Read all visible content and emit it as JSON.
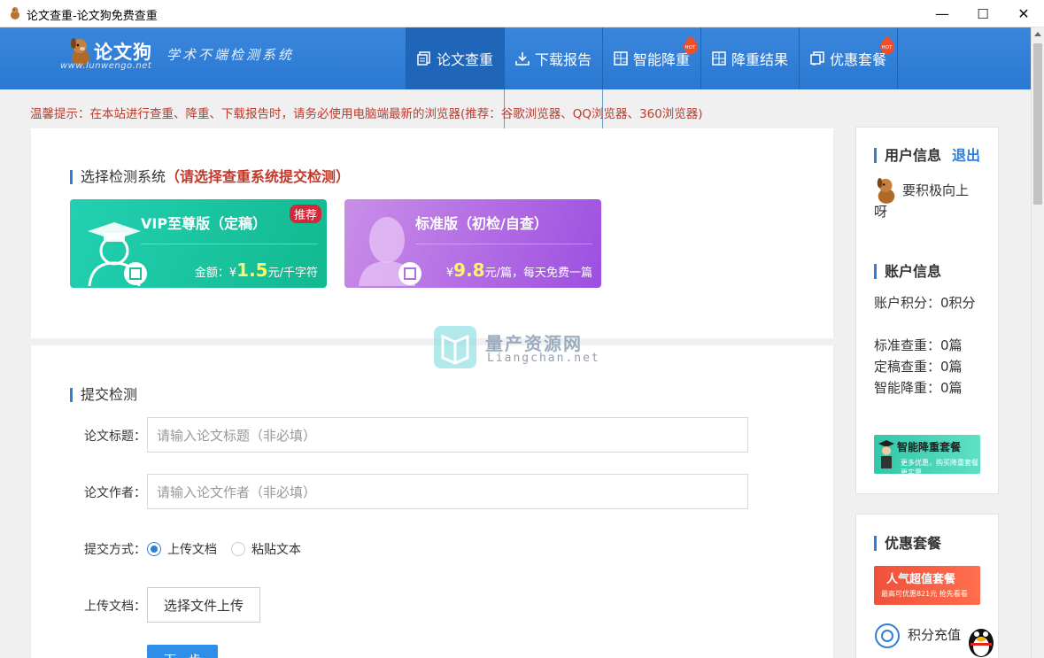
{
  "window": {
    "title": "论文查重-论文狗免费查重",
    "minimize": "—",
    "maximize": "☐",
    "close": "✕"
  },
  "header": {
    "logo_name": "论文狗",
    "logo_url": "www.lunwengo.net",
    "slogan": "学术不端检测系统",
    "nav": [
      {
        "label": "论文查重",
        "icon": "document-icon",
        "active": true,
        "hot": false
      },
      {
        "label": "下载报告",
        "icon": "download-icon",
        "active": false,
        "hot": false
      },
      {
        "label": "智能降重",
        "icon": "calculator-icon",
        "active": false,
        "hot": true
      },
      {
        "label": "降重结果",
        "icon": "calculator-icon",
        "active": false,
        "hot": false
      },
      {
        "label": "优惠套餐",
        "icon": "coupon-icon",
        "active": false,
        "hot": true
      }
    ],
    "hot_label": "HOT"
  },
  "notice": "温馨提示：在本站进行查重、降重、下载报告时，请务必使用电脑端最新的浏览器(推荐：谷歌浏览器、QQ浏览器、360浏览器)",
  "select_system": {
    "title": "选择检测系统",
    "title_hint": "（请选择查重系统提交检测）",
    "cards": [
      {
        "name": "VIP至尊版（定稿）",
        "tag": "推荐",
        "price_prefix": "金额：¥",
        "price": "1.5",
        "price_suffix": "元/千字符"
      },
      {
        "name": "标准版（初检/自查）",
        "tag": "",
        "price_prefix": "¥",
        "price": "9.8",
        "price_suffix": "元/篇，每天免费一篇"
      }
    ]
  },
  "submit": {
    "title": "提交检测",
    "paper_title_label": "论文标题：",
    "paper_title_placeholder": "请输入论文标题（非必填）",
    "author_label": "论文作者：",
    "author_placeholder": "请输入论文作者（非必填）",
    "method_label": "提交方式：",
    "method_options": [
      "上传文档",
      "粘贴文本"
    ],
    "method_selected": "上传文档",
    "upload_label": "上传文档：",
    "upload_button": "选择文件上传",
    "next_button": "下一步"
  },
  "watermark": {
    "text": "量产资源网",
    "sub": "Liangchan.net"
  },
  "sidebar": {
    "user_title": "用户信息",
    "logout": "退出",
    "username": "要积极向上呀",
    "account_title": "账户信息",
    "account_lines": [
      "账户积分：0积分",
      "标准查重：0篇",
      "定稿查重：0篇",
      "智能降重：0篇"
    ],
    "banner1_main": "智能降重套餐",
    "banner1_sub": "更多优惠，购买降重套餐更实惠",
    "package_title": "优惠套餐",
    "banner2_main": "人气超值套餐",
    "banner2_sub": "最高可优惠821元 抢先看看",
    "recharge_label": "积分充值"
  }
}
